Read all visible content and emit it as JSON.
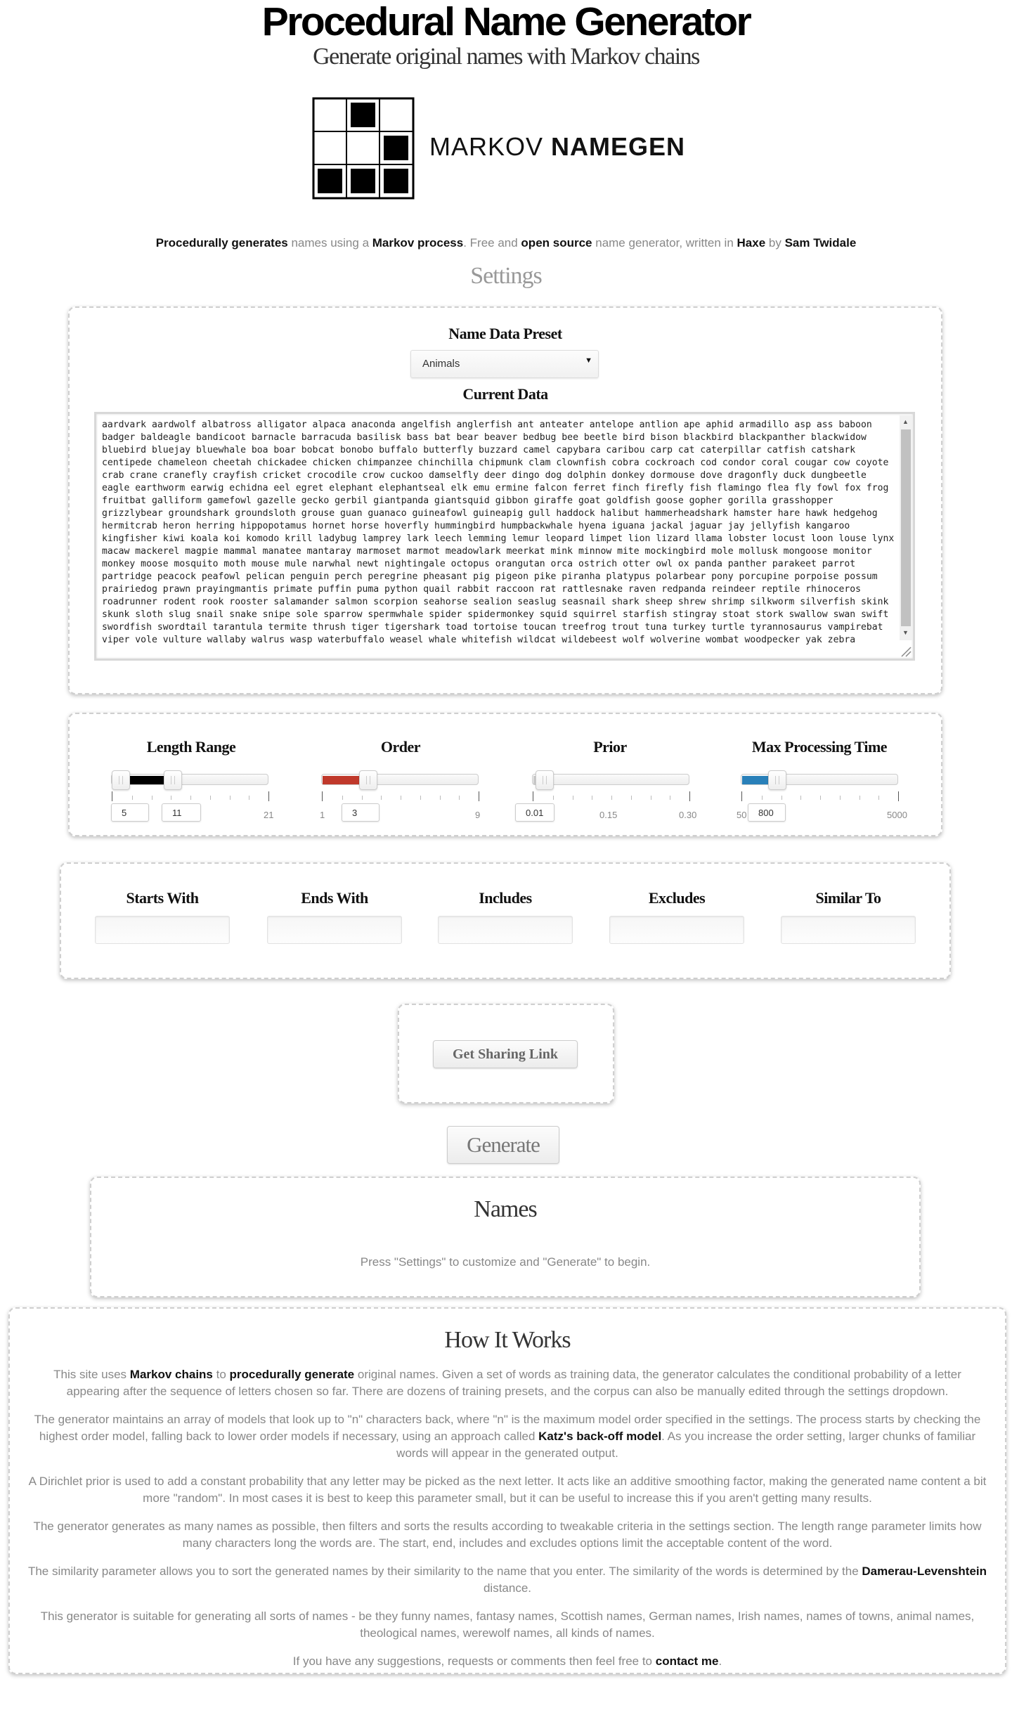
{
  "header": {
    "title": "Procedural Name Generator",
    "subtitle": "Generate original names with Markov chains"
  },
  "logo": {
    "text_regular": "MARKOV",
    "text_bold": "NAMEGEN"
  },
  "intro": {
    "link1": "Procedurally generates",
    "t1": " names using a ",
    "link2": "Markov process",
    "t2": ". Free and ",
    "link3": "open source",
    "t3": " name generator, written in ",
    "link4": "Haxe",
    "t4": " by ",
    "link5": "Sam Twidale"
  },
  "settings": {
    "heading": "Settings",
    "preset_label": "Name Data Preset",
    "preset_value": "Animals",
    "current_data_label": "Current Data",
    "current_data": "aardvark aardwolf albatross alligator alpaca anaconda angelfish anglerfish ant anteater antelope antlion ape aphid armadillo asp ass baboon badger baldeagle bandicoot barnacle barracuda basilisk bass bat bear beaver bedbug bee beetle bird bison blackbird blackpanther blackwidow bluebird bluejay bluewhale boa boar bobcat bonobo buffalo butterfly buzzard camel capybara caribou carp cat caterpillar catfish catshark centipede chameleon cheetah chickadee chicken chimpanzee chinchilla chipmunk clam clownfish cobra cockroach cod condor coral cougar cow coyote crab crane cranefly crayfish cricket crocodile crow cuckoo damselfly deer dingo dog dolphin donkey dormouse dove dragonfly duck dungbeetle eagle earthworm earwig echidna eel egret elephant elephantseal elk emu ermine falcon ferret finch firefly fish flamingo flea fly fowl fox frog fruitbat galliform gamefowl gazelle gecko gerbil giantpanda giantsquid gibbon giraffe goat goldfish goose gopher gorilla grasshopper grizzlybear groundshark groundsloth grouse guan guanaco guineafowl guineapig gull haddock halibut hammerheadshark hamster hare hawk hedgehog hermitcrab heron herring hippopotamus hornet horse hoverfly hummingbird humpbackwhale hyena iguana jackal jaguar jay jellyfish kangaroo kingfisher kiwi koala koi komodo krill ladybug lamprey lark leech lemming lemur leopard limpet lion lizard llama lobster locust loon louse lynx macaw mackerel magpie mammal manatee mantaray marmoset marmot meadowlark meerkat mink minnow mite mockingbird mole mollusk mongoose monitor monkey moose mosquito moth mouse mule narwhal newt nightingale octopus orangutan orca ostrich otter owl ox panda panther parakeet parrot partridge peacock peafowl pelican penguin perch peregrine pheasant pig pigeon pike piranha platypus polarbear pony porcupine porpoise possum prairiedog prawn prayingmantis primate puffin puma python quail rabbit raccoon rat rattlesnake raven redpanda reindeer reptile rhinoceros roadrunner rodent rook rooster salamander salmon scorpion seahorse sealion seaslug seasnail shark sheep shrew shrimp silkworm silverfish skink skunk sloth slug snail snake snipe sole sparrow spermwhale spider spidermonkey squid squirrel starfish stingray stoat stork swallow swan swift swordfish swordtail tarantula termite thrush tiger tigershark toad tortoise toucan treefrog trout tuna turkey turtle tyrannosaurus vampirebat viper vole vulture wallaby walrus wasp waterbuffalo weasel whale whitefish wildcat wildebeest wolf wolverine wombat woodpecker yak zebra"
  },
  "sliders": {
    "length": {
      "label": "Length Range",
      "min_label": "5",
      "max_label": "21",
      "low": 5,
      "high": 11,
      "low_text": "5",
      "high_text": "11",
      "fill_color": "#000000"
    },
    "order": {
      "label": "Order",
      "min_label": "1",
      "max_label": "9",
      "value": 3,
      "value_text": "3",
      "fill_color": "#c0392b"
    },
    "prior": {
      "label": "Prior",
      "min_label": "0.01",
      "mid_label": "0.15",
      "max_label": "0.30",
      "value": 0.01,
      "value_text": "0.01",
      "fill_color": "#cccccc"
    },
    "time": {
      "label": "Max Processing Time",
      "min_label": "50",
      "max_label": "5000",
      "value": 800,
      "value_text": "800",
      "fill_color": "#2980b9"
    }
  },
  "filters": {
    "starts_with": {
      "label": "Starts With",
      "value": ""
    },
    "ends_with": {
      "label": "Ends With",
      "value": ""
    },
    "includes": {
      "label": "Includes",
      "value": ""
    },
    "excludes": {
      "label": "Excludes",
      "value": ""
    },
    "similar_to": {
      "label": "Similar To",
      "value": ""
    }
  },
  "sharing": {
    "button_label": "Get Sharing Link"
  },
  "generate": {
    "button_label": "Generate"
  },
  "names": {
    "heading": "Names",
    "hint": "Press \"Settings\" to customize and \"Generate\" to begin."
  },
  "how": {
    "heading": "How It Works",
    "p1a": "This site uses ",
    "p1b": "Markov chains",
    "p1c": " to ",
    "p1d": "procedurally generate",
    "p1e": " original names. Given a set of words as training data, the generator calculates the conditional probability of a letter appearing after the sequence of letters chosen so far. There are dozens of training presets, and the corpus can also be manually edited through the settings dropdown.",
    "p2a": "The generator maintains an array of models that look up to \"n\" characters back, where \"n\" is the maximum model order specified in the settings. The process starts by checking the highest order model, falling back to lower order models if necessary, using an approach called ",
    "p2b": "Katz's back-off model",
    "p2c": ". As you increase the order setting, larger chunks of familiar words will appear in the generated output.",
    "p3": "A Dirichlet prior is used to add a constant probability that any letter may be picked as the next letter. It acts like an additive smoothing factor, making the generated name content a bit more \"random\". In most cases it is best to keep this parameter small, but it can be useful to increase this if you aren't getting many results.",
    "p4": "The generator generates as many names as possible, then filters and sorts the results according to tweakable criteria in the settings section. The length range parameter limits how many characters long the words are. The start, end, includes and excludes options limit the acceptable content of the word.",
    "p5a": "The similarity parameter allows you to sort the generated names by their similarity to the name that you enter. The similarity of the words is determined by the ",
    "p5b": "Damerau-Levenshtein",
    "p5c": " distance.",
    "p6": "This generator is suitable for generating all sorts of names - be they funny names, fantasy names, Scottish names, German names, Irish names, names of towns, animal names, theological names, werewolf names, all kinds of names.",
    "p7a": "If you have any suggestions, requests or comments then feel free to ",
    "p7b": "contact me",
    "p7c": "."
  }
}
